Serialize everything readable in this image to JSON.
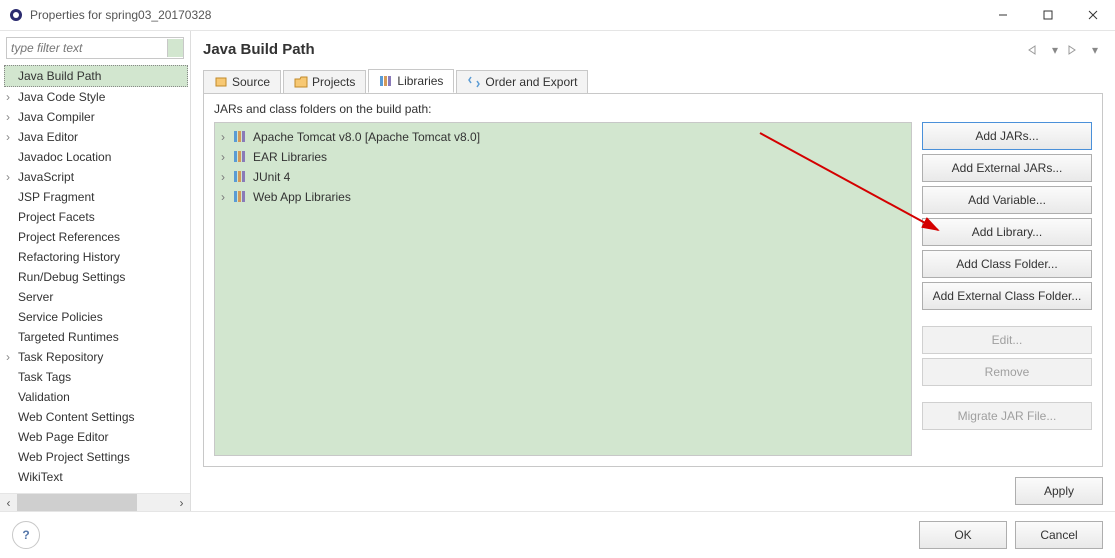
{
  "window": {
    "title": "Properties for spring03_20170328"
  },
  "filter": {
    "placeholder": "type filter text"
  },
  "nav": [
    {
      "label": "Java Build Path",
      "expandable": false,
      "selected": true
    },
    {
      "label": "Java Code Style",
      "expandable": true,
      "selected": false
    },
    {
      "label": "Java Compiler",
      "expandable": true,
      "selected": false
    },
    {
      "label": "Java Editor",
      "expandable": true,
      "selected": false
    },
    {
      "label": "Javadoc Location",
      "expandable": false,
      "selected": false
    },
    {
      "label": "JavaScript",
      "expandable": true,
      "selected": false
    },
    {
      "label": "JSP Fragment",
      "expandable": false,
      "selected": false
    },
    {
      "label": "Project Facets",
      "expandable": false,
      "selected": false
    },
    {
      "label": "Project References",
      "expandable": false,
      "selected": false
    },
    {
      "label": "Refactoring History",
      "expandable": false,
      "selected": false
    },
    {
      "label": "Run/Debug Settings",
      "expandable": false,
      "selected": false
    },
    {
      "label": "Server",
      "expandable": false,
      "selected": false
    },
    {
      "label": "Service Policies",
      "expandable": false,
      "selected": false
    },
    {
      "label": "Targeted Runtimes",
      "expandable": false,
      "selected": false
    },
    {
      "label": "Task Repository",
      "expandable": true,
      "selected": false
    },
    {
      "label": "Task Tags",
      "expandable": false,
      "selected": false
    },
    {
      "label": "Validation",
      "expandable": false,
      "selected": false
    },
    {
      "label": "Web Content Settings",
      "expandable": false,
      "selected": false
    },
    {
      "label": "Web Page Editor",
      "expandable": false,
      "selected": false
    },
    {
      "label": "Web Project Settings",
      "expandable": false,
      "selected": false
    },
    {
      "label": "WikiText",
      "expandable": false,
      "selected": false
    }
  ],
  "page": {
    "title": "Java Build Path",
    "description": "JARs and class folders on the build path:"
  },
  "tabs": [
    {
      "label": "Source",
      "active": false,
      "icon": "source"
    },
    {
      "label": "Projects",
      "active": false,
      "icon": "projects"
    },
    {
      "label": "Libraries",
      "active": true,
      "icon": "libraries"
    },
    {
      "label": "Order and Export",
      "active": false,
      "icon": "order"
    }
  ],
  "libraries": [
    {
      "label": "Apache Tomcat v8.0 [Apache Tomcat v8.0]"
    },
    {
      "label": "EAR Libraries"
    },
    {
      "label": "JUnit 4"
    },
    {
      "label": "Web App Libraries"
    }
  ],
  "buttons": {
    "addJars": "Add JARs...",
    "addExternalJars": "Add External JARs...",
    "addVariable": "Add Variable...",
    "addLibrary": "Add Library...",
    "addClassFolder": "Add Class Folder...",
    "addExternalClassFolder": "Add External Class Folder...",
    "edit": "Edit...",
    "remove": "Remove",
    "migrate": "Migrate JAR File...",
    "apply": "Apply",
    "ok": "OK",
    "cancel": "Cancel"
  }
}
